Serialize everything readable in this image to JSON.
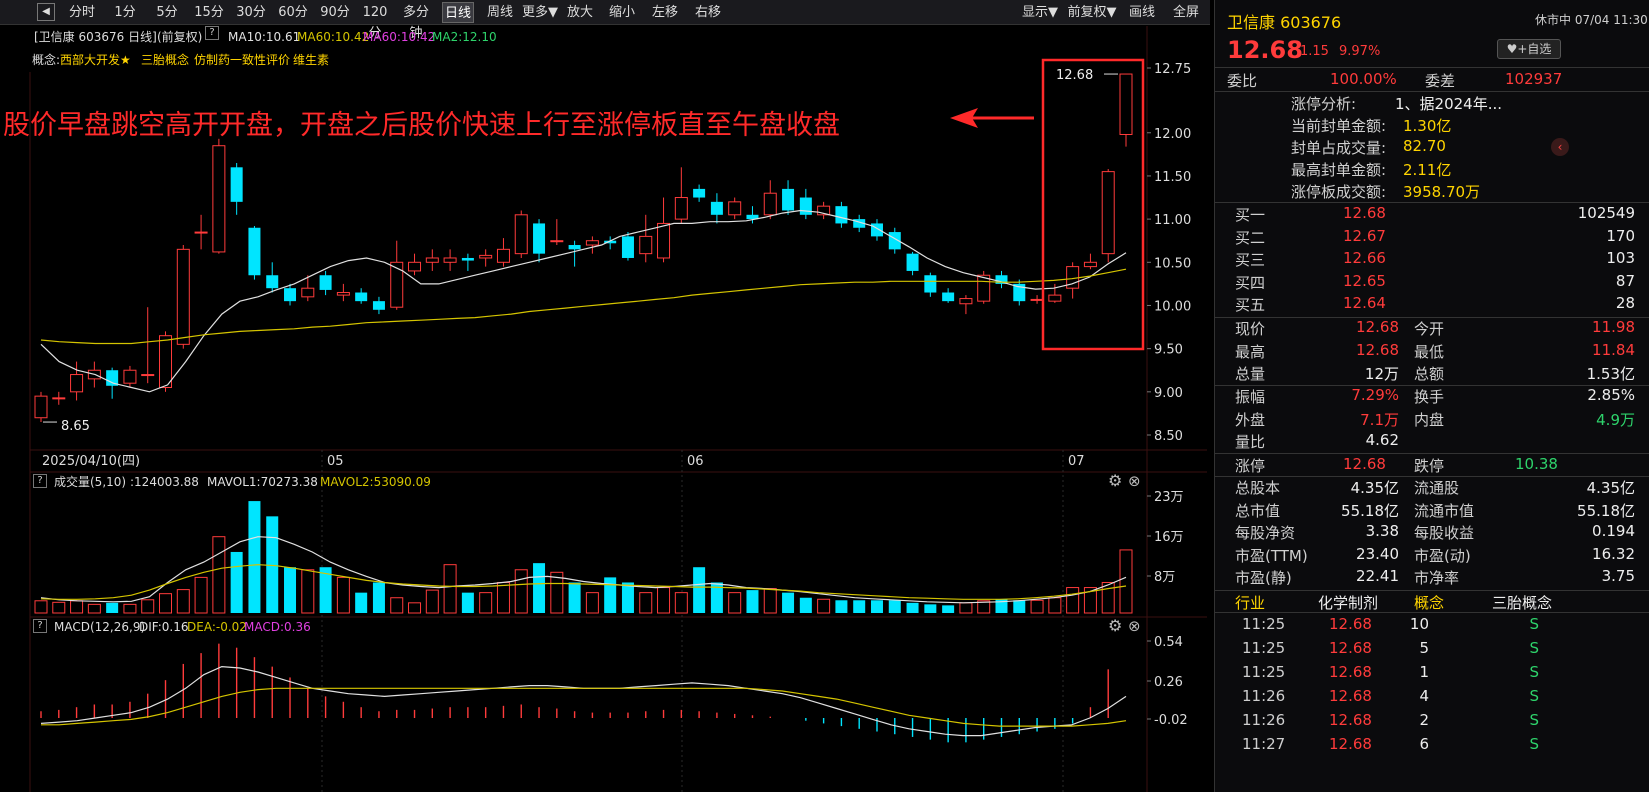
{
  "toolbar": {
    "items": [
      "分时",
      "1分",
      "5分",
      "15分",
      "30分",
      "60分",
      "90分",
      "120分",
      "多分钟",
      "日线",
      "周线",
      "更多▼",
      "放大",
      "缩小",
      "左移",
      "右移"
    ],
    "active": "日线",
    "right_items": [
      "显示▼",
      "前复权▼",
      "画线",
      "全屏"
    ]
  },
  "info": {
    "title": "[卫信康 603676 日线]",
    "adj": "(前复权)",
    "help": "?",
    "ma10": "MA10:10.61",
    "ma60a": "MA60:10.42",
    "ma60b": "MA60:10.42",
    "ma2": "MA2:12.10"
  },
  "concepts": {
    "label": "概念:",
    "items": [
      "西部大开发★",
      "三胎概念",
      "仿制药一致性评价",
      "维生素"
    ]
  },
  "annotation": "股价早盘跳空高开开盘，开盘之后股价快速上行至涨停板直至午盘收盘",
  "colors": {
    "up": "#ff3b3b",
    "down": "#00e5ff",
    "ma_short": "#e0e0e0",
    "ma_long": "#d4c400",
    "highlight": "#ff2a2a"
  },
  "chart_data": {
    "type": "candlestick",
    "price_axis": {
      "ticks": [
        "12.75",
        "12.00",
        "11.50",
        "11.00",
        "10.50",
        "10.00",
        "9.50",
        "9.00",
        "8.50"
      ],
      "range": [
        8.5,
        12.75
      ]
    },
    "date_labels": [
      "2025/04/10(四)",
      "05",
      "06",
      "07"
    ],
    "high_label": "12.68",
    "low_label": "8.65",
    "candles": [
      {
        "o": 8.7,
        "c": 8.95,
        "h": 9.0,
        "l": 8.65
      },
      {
        "o": 8.92,
        "c": 8.93,
        "h": 9.0,
        "l": 8.85
      },
      {
        "o": 9.0,
        "c": 9.2,
        "h": 9.35,
        "l": 8.9
      },
      {
        "o": 9.15,
        "c": 9.25,
        "h": 9.35,
        "l": 9.05
      },
      {
        "o": 9.25,
        "c": 9.07,
        "h": 9.28,
        "l": 8.92
      },
      {
        "o": 9.1,
        "c": 9.25,
        "h": 9.3,
        "l": 9.05
      },
      {
        "o": 9.2,
        "c": 9.2,
        "h": 9.98,
        "l": 9.1
      },
      {
        "o": 9.05,
        "c": 9.65,
        "h": 9.7,
        "l": 9.0
      },
      {
        "o": 9.55,
        "c": 10.65,
        "h": 10.7,
        "l": 9.5
      },
      {
        "o": 10.85,
        "c": 10.85,
        "h": 11.05,
        "l": 10.65
      },
      {
        "o": 10.62,
        "c": 11.85,
        "h": 11.93,
        "l": 10.6
      },
      {
        "o": 11.6,
        "c": 11.2,
        "h": 11.65,
        "l": 11.05
      },
      {
        "o": 10.9,
        "c": 10.35,
        "h": 10.92,
        "l": 10.3
      },
      {
        "o": 10.35,
        "c": 10.2,
        "h": 10.5,
        "l": 10.15
      },
      {
        "o": 10.2,
        "c": 10.05,
        "h": 10.25,
        "l": 10.0
      },
      {
        "o": 10.1,
        "c": 10.2,
        "h": 10.35,
        "l": 10.05
      },
      {
        "o": 10.35,
        "c": 10.18,
        "h": 10.4,
        "l": 10.12
      },
      {
        "o": 10.12,
        "c": 10.15,
        "h": 10.25,
        "l": 10.05
      },
      {
        "o": 10.15,
        "c": 10.05,
        "h": 10.2,
        "l": 10.02
      },
      {
        "o": 10.05,
        "c": 9.95,
        "h": 10.1,
        "l": 9.9
      },
      {
        "o": 9.98,
        "c": 10.5,
        "h": 10.75,
        "l": 9.95
      },
      {
        "o": 10.4,
        "c": 10.5,
        "h": 10.6,
        "l": 10.35
      },
      {
        "o": 10.5,
        "c": 10.55,
        "h": 10.65,
        "l": 10.4
      },
      {
        "o": 10.5,
        "c": 10.55,
        "h": 10.65,
        "l": 10.4
      },
      {
        "o": 10.55,
        "c": 10.52,
        "h": 10.6,
        "l": 10.4
      },
      {
        "o": 10.55,
        "c": 10.58,
        "h": 10.65,
        "l": 10.45
      },
      {
        "o": 10.5,
        "c": 10.65,
        "h": 10.78,
        "l": 10.45
      },
      {
        "o": 10.6,
        "c": 11.05,
        "h": 11.1,
        "l": 10.55
      },
      {
        "o": 10.95,
        "c": 10.6,
        "h": 11.0,
        "l": 10.5
      },
      {
        "o": 10.75,
        "c": 10.75,
        "h": 11.0,
        "l": 10.7
      },
      {
        "o": 10.7,
        "c": 10.65,
        "h": 10.75,
        "l": 10.45
      },
      {
        "o": 10.7,
        "c": 10.75,
        "h": 10.8,
        "l": 10.6
      },
      {
        "o": 10.75,
        "c": 10.72,
        "h": 10.8,
        "l": 10.65
      },
      {
        "o": 10.8,
        "c": 10.55,
        "h": 10.85,
        "l": 10.52
      },
      {
        "o": 10.6,
        "c": 10.8,
        "h": 11.05,
        "l": 10.5
      },
      {
        "o": 10.55,
        "c": 10.95,
        "h": 11.25,
        "l": 10.5
      },
      {
        "o": 11.0,
        "c": 11.25,
        "h": 11.6,
        "l": 10.95
      },
      {
        "o": 11.35,
        "c": 11.25,
        "h": 11.4,
        "l": 11.2
      },
      {
        "o": 11.2,
        "c": 11.05,
        "h": 11.3,
        "l": 10.95
      },
      {
        "o": 11.05,
        "c": 11.2,
        "h": 11.25,
        "l": 11.0
      },
      {
        "o": 11.05,
        "c": 11.0,
        "h": 11.15,
        "l": 10.95
      },
      {
        "o": 11.05,
        "c": 11.3,
        "h": 11.45,
        "l": 11.0
      },
      {
        "o": 11.35,
        "c": 11.1,
        "h": 11.45,
        "l": 11.05
      },
      {
        "o": 11.25,
        "c": 11.05,
        "h": 11.35,
        "l": 11.0
      },
      {
        "o": 11.05,
        "c": 11.15,
        "h": 11.2,
        "l": 11.0
      },
      {
        "o": 11.15,
        "c": 10.95,
        "h": 11.2,
        "l": 10.9
      },
      {
        "o": 11.0,
        "c": 10.9,
        "h": 11.05,
        "l": 10.85
      },
      {
        "o": 10.95,
        "c": 10.8,
        "h": 11.0,
        "l": 10.75
      },
      {
        "o": 10.85,
        "c": 10.65,
        "h": 10.9,
        "l": 10.6
      },
      {
        "o": 10.6,
        "c": 10.4,
        "h": 10.62,
        "l": 10.35
      },
      {
        "o": 10.35,
        "c": 10.15,
        "h": 10.38,
        "l": 10.1
      },
      {
        "o": 10.15,
        "c": 10.05,
        "h": 10.2,
        "l": 10.03
      },
      {
        "o": 10.02,
        "c": 10.08,
        "h": 10.12,
        "l": 9.9
      },
      {
        "o": 10.05,
        "c": 10.35,
        "h": 10.4,
        "l": 10.02
      },
      {
        "o": 10.35,
        "c": 10.25,
        "h": 10.4,
        "l": 10.2
      },
      {
        "o": 10.25,
        "c": 10.05,
        "h": 10.3,
        "l": 10.0
      },
      {
        "o": 10.07,
        "c": 10.07,
        "h": 10.12,
        "l": 10.02
      },
      {
        "o": 10.05,
        "c": 10.12,
        "h": 10.25,
        "l": 10.03
      },
      {
        "o": 10.2,
        "c": 10.45,
        "h": 10.5,
        "l": 10.08
      },
      {
        "o": 10.45,
        "c": 10.5,
        "h": 10.6,
        "l": 10.42
      },
      {
        "o": 10.6,
        "c": 11.55,
        "h": 11.58,
        "l": 10.5
      },
      {
        "o": 11.98,
        "c": 12.68,
        "h": 12.68,
        "l": 11.84
      }
    ],
    "ma_short_label": "MA10",
    "ma_long_label": "MA60",
    "ma_short": [
      9.55,
      9.35,
      9.25,
      9.2,
      9.1,
      9.05,
      9.0,
      9.08,
      9.35,
      9.65,
      9.9,
      10.05,
      10.1,
      10.18,
      10.25,
      10.35,
      10.45,
      10.52,
      10.55,
      10.5,
      10.4,
      10.25,
      10.25,
      10.3,
      10.35,
      10.4,
      10.45,
      10.5,
      10.55,
      10.6,
      10.65,
      10.7,
      10.8,
      10.85,
      10.9,
      10.95,
      10.95,
      10.97,
      10.97,
      10.98,
      11.02,
      11.07,
      11.1,
      11.08,
      11.03,
      10.98,
      10.92,
      10.8,
      10.68,
      10.55,
      10.45,
      10.38,
      10.33,
      10.28,
      10.22,
      10.19,
      10.2,
      10.25,
      10.33,
      10.48,
      10.61
    ],
    "ma_long": [
      9.6,
      9.58,
      9.57,
      9.56,
      9.56,
      9.56,
      9.58,
      9.6,
      9.63,
      9.66,
      9.68,
      9.7,
      9.71,
      9.72,
      9.73,
      9.75,
      9.76,
      9.78,
      9.8,
      9.81,
      9.82,
      9.83,
      9.84,
      9.85,
      9.86,
      9.88,
      9.9,
      9.93,
      9.95,
      9.97,
      9.99,
      10.01,
      10.03,
      10.05,
      10.07,
      10.09,
      10.12,
      10.14,
      10.16,
      10.18,
      10.2,
      10.22,
      10.24,
      10.25,
      10.26,
      10.27,
      10.27,
      10.28,
      10.28,
      10.28,
      10.28,
      10.28,
      10.28,
      10.27,
      10.27,
      10.28,
      10.29,
      10.31,
      10.34,
      10.38,
      10.42
    ],
    "volume": {
      "label": "成交量(5,10)",
      "value": ":124003.88",
      "mavol1": "MAVOL1:70273.38",
      "mavol2": "MAVOL2:53090.09",
      "ticks": [
        "23万",
        "16万",
        "8万"
      ],
      "max": 230000,
      "bars": [
        24000,
        21000,
        24000,
        17000,
        20000,
        17000,
        26000,
        38000,
        46000,
        70000,
        150000,
        120000,
        220000,
        190000,
        90000,
        85000,
        90000,
        70000,
        40000,
        60000,
        30000,
        20000,
        45000,
        95000,
        40000,
        40000,
        60000,
        85000,
        98000,
        80000,
        60000,
        40000,
        70000,
        60000,
        40000,
        50000,
        40000,
        90000,
        60000,
        40000,
        45000,
        48000,
        40000,
        30000,
        27000,
        25000,
        25000,
        25000,
        25000,
        20000,
        17000,
        15000,
        20000,
        24000,
        27000,
        25000,
        25000,
        30000,
        50000,
        50000,
        60000,
        124003
      ],
      "mavol1_line": [
        30000,
        26000,
        24000,
        23000,
        22000,
        23000,
        32000,
        60000,
        85000,
        100000,
        120000,
        140000,
        150000,
        148000,
        135000,
        120000,
        100000,
        85000,
        72000,
        60000,
        55000,
        52000,
        50000,
        53000,
        55000,
        58000,
        62000,
        70000,
        72000,
        68000,
        62000,
        58000,
        55000,
        52000,
        50000,
        52000,
        55000,
        58000,
        55000,
        50000,
        48000,
        45000,
        42000,
        38000,
        34000,
        30000,
        28000,
        26000,
        24000,
        22000,
        21000,
        20000,
        21000,
        22000,
        24000,
        27000,
        30000,
        35000,
        42000,
        55000,
        70273
      ],
      "mavol2_line": [
        28000,
        27000,
        27000,
        28000,
        30000,
        35000,
        45000,
        58000,
        70000,
        80000,
        88000,
        92000,
        95000,
        93000,
        88000,
        82000,
        76000,
        70000,
        64000,
        60000,
        57000,
        55000,
        53000,
        52000,
        52000,
        53000,
        55000,
        57000,
        58000,
        58000,
        57000,
        56000,
        55000,
        54000,
        53000,
        52000,
        51000,
        51000,
        50000,
        49000,
        47000,
        45000,
        43000,
        40000,
        38000,
        36000,
        34000,
        32000,
        30000,
        29000,
        28000,
        27000,
        27000,
        27000,
        28000,
        30000,
        33000,
        37000,
        42000,
        48000,
        53090
      ]
    },
    "macd": {
      "label": "MACD(12,26,9)",
      "dif": "DIF:0.16",
      "dea": "DEA:-0.02",
      "macd": "MACD:0.36",
      "ticks": [
        "0.54",
        "0.26",
        "-0.02"
      ],
      "bars": [
        0.05,
        0.06,
        0.08,
        0.1,
        0.1,
        0.12,
        0.18,
        0.28,
        0.4,
        0.48,
        0.55,
        0.52,
        0.45,
        0.38,
        0.3,
        0.22,
        0.16,
        0.12,
        0.08,
        0.05,
        0.06,
        0.06,
        0.07,
        0.08,
        0.08,
        0.08,
        0.09,
        0.1,
        0.08,
        0.07,
        0.05,
        0.04,
        0.04,
        0.04,
        0.05,
        0.06,
        0.06,
        0.05,
        0.04,
        0.03,
        0.02,
        0.01,
        0.0,
        -0.02,
        -0.04,
        -0.06,
        -0.08,
        -0.1,
        -0.12,
        -0.14,
        -0.16,
        -0.18,
        -0.18,
        -0.16,
        -0.14,
        -0.12,
        -0.1,
        -0.08,
        -0.04,
        0.08,
        0.36
      ],
      "dif_line": [
        -0.04,
        -0.03,
        -0.02,
        0.0,
        0.02,
        0.04,
        0.08,
        0.14,
        0.22,
        0.32,
        0.38,
        0.37,
        0.34,
        0.3,
        0.26,
        0.22,
        0.2,
        0.18,
        0.17,
        0.16,
        0.17,
        0.18,
        0.19,
        0.2,
        0.21,
        0.22,
        0.23,
        0.24,
        0.24,
        0.23,
        0.22,
        0.22,
        0.22,
        0.23,
        0.24,
        0.25,
        0.26,
        0.25,
        0.24,
        0.22,
        0.2,
        0.18,
        0.15,
        0.11,
        0.07,
        0.03,
        -0.01,
        -0.05,
        -0.08,
        -0.1,
        -0.12,
        -0.13,
        -0.13,
        -0.11,
        -0.09,
        -0.07,
        -0.06,
        -0.05,
        0.0,
        0.07,
        0.16
      ],
      "dea_line": [
        -0.05,
        -0.05,
        -0.04,
        -0.03,
        -0.02,
        -0.01,
        0.01,
        0.04,
        0.08,
        0.12,
        0.16,
        0.19,
        0.21,
        0.22,
        0.22,
        0.22,
        0.22,
        0.22,
        0.22,
        0.22,
        0.22,
        0.22,
        0.22,
        0.22,
        0.22,
        0.22,
        0.22,
        0.22,
        0.22,
        0.22,
        0.22,
        0.22,
        0.22,
        0.22,
        0.22,
        0.22,
        0.22,
        0.22,
        0.22,
        0.22,
        0.21,
        0.2,
        0.18,
        0.16,
        0.14,
        0.11,
        0.08,
        0.05,
        0.02,
        0.0,
        -0.02,
        -0.04,
        -0.05,
        -0.06,
        -0.06,
        -0.06,
        -0.06,
        -0.06,
        -0.05,
        -0.04,
        -0.02
      ]
    }
  },
  "right": {
    "name": "卫信康 603676",
    "status": "休市中 07/04 11:30",
    "price": "12.68",
    "change": "1.15",
    "pct": "9.97%",
    "watch": "+自选",
    "weibi_label": "委比",
    "weibi": "100.00%",
    "weicha_label": "委差",
    "weicha": "102937",
    "zt_label": "涨停分析:",
    "zt_value": "1、据2024年...",
    "fd_label": "当前封单金额:",
    "fd_value": "1.30亿",
    "fz_label": "封单占成交量:",
    "fz_value": "82.70",
    "zg_label": "最高封单金额:",
    "zg_value": "2.11亿",
    "zb_label": "涨停板成交额:",
    "zb_value": "3958.70万",
    "bids": [
      {
        "label": "买一",
        "price": "12.68",
        "vol": "102549"
      },
      {
        "label": "买二",
        "price": "12.67",
        "vol": "170"
      },
      {
        "label": "买三",
        "price": "12.66",
        "vol": "103"
      },
      {
        "label": "买四",
        "price": "12.65",
        "vol": "87"
      },
      {
        "label": "买五",
        "price": "12.64",
        "vol": "28"
      }
    ],
    "stats1": [
      {
        "l1": "现价",
        "v1": "12.68",
        "c1": "red",
        "l2": "今开",
        "v2": "11.98",
        "c2": "red"
      },
      {
        "l1": "最高",
        "v1": "12.68",
        "c1": "red",
        "l2": "最低",
        "v2": "11.84",
        "c2": "red"
      },
      {
        "l1": "总量",
        "v1": "12万",
        "c1": "white",
        "l2": "总额",
        "v2": "1.53亿",
        "c2": "white"
      }
    ],
    "stats2": [
      {
        "l1": "振幅",
        "v1": "7.29%",
        "c1": "red",
        "l2": "换手",
        "v2": "2.85%",
        "c2": "white"
      },
      {
        "l1": "外盘",
        "v1": "7.1万",
        "c1": "red",
        "l2": "内盘",
        "v2": "4.9万",
        "c2": "green"
      },
      {
        "l1": "量比",
        "v1": "4.62",
        "c1": "white",
        "l2": "",
        "v2": "",
        "c2": "white"
      }
    ],
    "limit": {
      "l1": "涨停",
      "v1": "12.68",
      "l2": "跌停",
      "v2": "10.38"
    },
    "stats3": [
      {
        "l1": "总股本",
        "v1": "4.35亿",
        "l2": "流通股",
        "v2": "4.35亿"
      },
      {
        "l1": "总市值",
        "v1": "55.18亿",
        "l2": "流通市值",
        "v2": "55.18亿"
      },
      {
        "l1": "每股净资",
        "v1": "3.38",
        "l2": "每股收益",
        "v2": "0.194"
      },
      {
        "l1": "市盈(TTM)",
        "v1": "23.40",
        "l2": "市盈(动)",
        "v2": "16.32"
      },
      {
        "l1": "市盈(静)",
        "v1": "22.41",
        "l2": "市净率",
        "v2": "3.75"
      }
    ],
    "tabs": {
      "a": "行业",
      "b": "化学制剂",
      "c": "概念",
      "d": "三胎概念"
    },
    "ticks": [
      {
        "t": "11:25",
        "p": "12.68",
        "v": "10",
        "s": "S"
      },
      {
        "t": "11:25",
        "p": "12.68",
        "v": "5",
        "s": "S"
      },
      {
        "t": "11:25",
        "p": "12.68",
        "v": "1",
        "s": "S"
      },
      {
        "t": "11:26",
        "p": "12.68",
        "v": "4",
        "s": "S"
      },
      {
        "t": "11:26",
        "p": "12.68",
        "v": "2",
        "s": "S"
      },
      {
        "t": "11:27",
        "p": "12.68",
        "v": "6",
        "s": "S"
      }
    ]
  }
}
